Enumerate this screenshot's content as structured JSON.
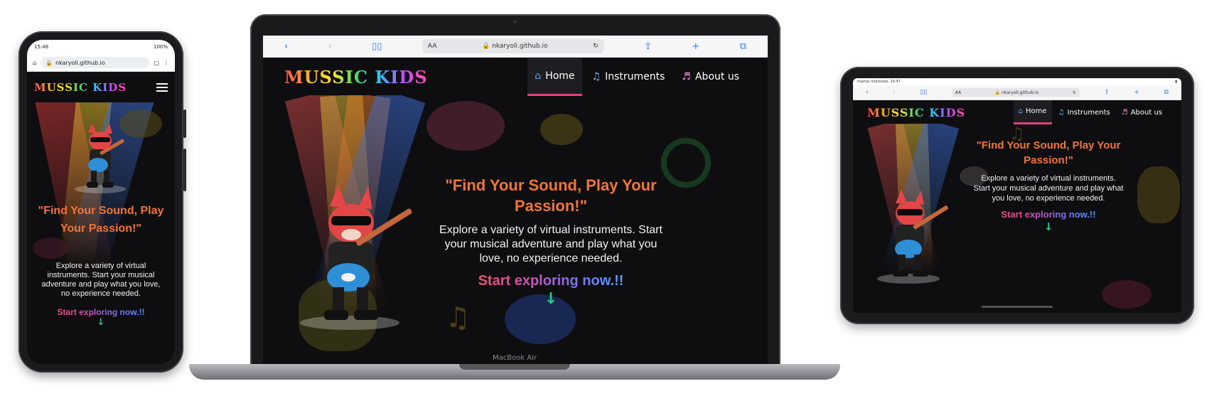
{
  "phone": {
    "status_time": "15:48",
    "status_right": "100%",
    "url": "nkaryoli.github.io",
    "logo": "MUSSIC KIDS",
    "headline": "\"Find Your Sound, Play Your Passion!\"",
    "subtitle": "Explore a variety of virtual instruments. Start your musical adventure and play what you love, no experience needed.",
    "cta": "Start exploring now.!!",
    "arrow": "↓"
  },
  "laptop": {
    "url_aa": "AA",
    "url": "nkaryoli.github.io",
    "logo": "MUSSIC KIDS",
    "nav": [
      {
        "label": "Home",
        "icon": "home-icon"
      },
      {
        "label": "Instruments",
        "icon": "music-note-icon"
      },
      {
        "label": "About us",
        "icon": "music-chat-icon"
      }
    ],
    "headline": "\"Find Your Sound, Play Your Passion!\"",
    "subtitle": "Explore a variety of virtual instruments. Start your musical adventure and play what you love, no experience needed.",
    "cta": "Start exploring now.!!",
    "arrow": "↓",
    "model": "MacBook Air"
  },
  "tablet": {
    "status_left": "martes miércoles, 16:47",
    "url_aa": "AA",
    "url": "nkaryoli.github.io",
    "logo": "MUSSIC KIDS",
    "nav": [
      {
        "label": "Home",
        "icon": "home-icon"
      },
      {
        "label": "Instruments",
        "icon": "music-note-icon"
      },
      {
        "label": "About us",
        "icon": "music-chat-icon"
      }
    ],
    "headline": "\"Find Your Sound, Play Your Passion!\"",
    "subtitle": "Explore a variety of virtual instruments. Start your musical adventure and play what you love, no experience needed.",
    "cta": "Start exploring now.!!",
    "arrow": "↓"
  },
  "colors": {
    "background": "#0e0e10",
    "headline": "#f0753a",
    "active_tab_underline": "#e0407a",
    "arrow": "#27c98a",
    "browser_accent": "#2a7bf2"
  }
}
